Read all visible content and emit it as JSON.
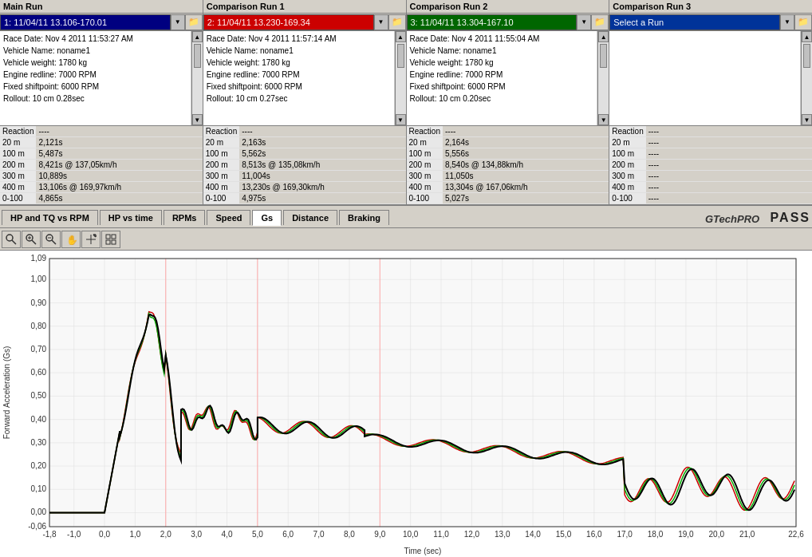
{
  "runs": {
    "main": {
      "title": "Main Run",
      "selector_value": "1:  11/04/11  13.106-170.01",
      "info": [
        "Race Date: Nov 4 2011  11:53:27 AM",
        "Vehicle Name: noname1",
        "Vehicle weight: 1780 kg",
        "Engine redline: 7000 RPM",
        "Fixed shiftpoint: 6000 RPM",
        "Rollout: 10 cm  0.28sec"
      ],
      "reaction": [
        {
          "label": "Reaction",
          "value": "----"
        },
        {
          "label": "20 m",
          "value": "2,121s"
        },
        {
          "label": "100 m",
          "value": "5,487s"
        },
        {
          "label": "200 m",
          "value": "8,421s @ 137,05km/h"
        },
        {
          "label": "300 m",
          "value": "10,889s"
        },
        {
          "label": "400 m",
          "value": "13,106s @ 169,97km/h"
        },
        {
          "label": "0-100",
          "value": "4,865s"
        }
      ]
    },
    "comp1": {
      "title": "Comparison Run 1",
      "selector_value": "2:  11/04/11  13.230-169.34",
      "info": [
        "Race Date: Nov 4 2011  11:57:14 AM",
        "Vehicle Name: noname1",
        "Vehicle weight: 1780 kg",
        "Engine redline: 7000 RPM",
        "Fixed shiftpoint: 6000 RPM",
        "Rollout: 10 cm  0.27sec"
      ],
      "reaction": [
        {
          "label": "Reaction",
          "value": "----"
        },
        {
          "label": "20 m",
          "value": "2,163s"
        },
        {
          "label": "100 m",
          "value": "5,562s"
        },
        {
          "label": "200 m",
          "value": "8,513s @ 135,08km/h"
        },
        {
          "label": "300 m",
          "value": "11,004s"
        },
        {
          "label": "400 m",
          "value": "13,230s @ 169,30km/h"
        },
        {
          "label": "0-100",
          "value": "4,975s"
        }
      ]
    },
    "comp2": {
      "title": "Comparison Run 2",
      "selector_value": "3:  11/04/11  13.304-167.10",
      "info": [
        "Race Date: Nov 4 2011  11:55:04 AM",
        "Vehicle Name: noname1",
        "Vehicle weight: 1780 kg",
        "Engine redline: 7000 RPM",
        "Fixed shiftpoint: 6000 RPM",
        "Rollout: 10 cm  0.20sec"
      ],
      "reaction": [
        {
          "label": "Reaction",
          "value": "----"
        },
        {
          "label": "20 m",
          "value": "2,164s"
        },
        {
          "label": "100 m",
          "value": "5,556s"
        },
        {
          "label": "200 m",
          "value": "8,540s @ 134,88km/h"
        },
        {
          "label": "300 m",
          "value": "11,050s"
        },
        {
          "label": "400 m",
          "value": "13,304s @ 167,06km/h"
        },
        {
          "label": "0-100",
          "value": "5,027s"
        }
      ]
    },
    "comp3": {
      "title": "Comparison Run 3",
      "selector_value": "Select a Run",
      "info": [],
      "reaction": [
        {
          "label": "Reaction",
          "value": "----"
        },
        {
          "label": "20 m",
          "value": "----"
        },
        {
          "label": "100 m",
          "value": "----"
        },
        {
          "label": "200 m",
          "value": "----"
        },
        {
          "label": "300 m",
          "value": "----"
        },
        {
          "label": "400 m",
          "value": "----"
        },
        {
          "label": "0-100",
          "value": "----"
        }
      ]
    }
  },
  "tabs": [
    {
      "label": "HP and TQ vs RPM",
      "active": false
    },
    {
      "label": "HP vs time",
      "active": false
    },
    {
      "label": "RPMs",
      "active": false
    },
    {
      "label": "Speed",
      "active": false
    },
    {
      "label": "Gs",
      "active": true
    },
    {
      "label": "Distance",
      "active": false
    },
    {
      "label": "Braking",
      "active": false
    }
  ],
  "logo": {
    "gtech": "GTechPRO",
    "pass": "PASS"
  },
  "toolbar": {
    "tools": [
      "🔍",
      "⊞",
      "🔍",
      "✋",
      "↗",
      "▦"
    ]
  },
  "chart": {
    "x_label": "Time (sec)",
    "y_label": "Forward Acceleration (Gs)",
    "x_min": -1.8,
    "x_max": 22.6,
    "y_min": -0.06,
    "y_max": 1.09,
    "x_ticks": [
      -1.8,
      -1.0,
      0.0,
      1.0,
      2.0,
      3.0,
      4.0,
      5.0,
      6.0,
      7.0,
      8.0,
      9.0,
      10.0,
      11.0,
      12.0,
      13.0,
      14.0,
      15.0,
      16.0,
      17.0,
      18.0,
      19.0,
      20.0,
      21.0,
      22.6
    ],
    "y_ticks": [
      -0.06,
      0.0,
      0.1,
      0.2,
      0.3,
      0.4,
      0.5,
      0.6,
      0.7,
      0.8,
      0.9,
      1.0,
      1.09
    ]
  }
}
